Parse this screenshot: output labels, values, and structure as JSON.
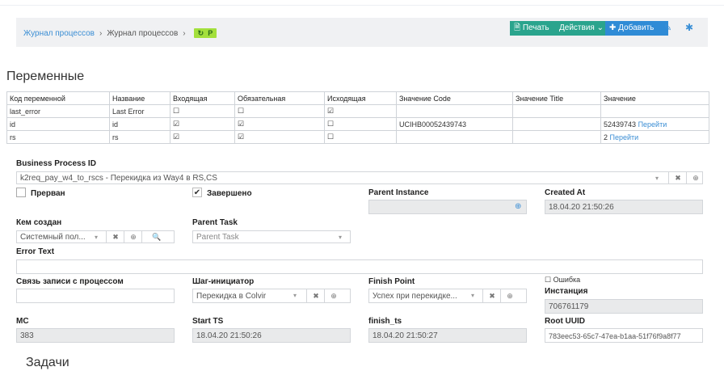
{
  "breadcrumb": {
    "items": [
      "Журнал процессов",
      "Журнал процессов"
    ],
    "chip_glyph": "↻",
    "chip_flag": "Р"
  },
  "toolbar": {
    "print_label": "Печать",
    "actions_label": "Действия",
    "add_label": "Добавить"
  },
  "sections": {
    "variables": "Переменные",
    "tasks": "Задачи"
  },
  "vars_table": {
    "headers": [
      "Код переменной",
      "Название",
      "Входящая",
      "Обязательная",
      "Исходящая",
      "Значение Code",
      "Значение Title",
      "Значение"
    ],
    "rows": [
      {
        "code": "last_error",
        "name": "Last Error",
        "in": false,
        "req": false,
        "out": true,
        "value_code": "",
        "value_title": "",
        "value": "",
        "link": ""
      },
      {
        "code": "id",
        "name": "id",
        "in": true,
        "req": true,
        "out": false,
        "value_code": "UCIHB00052439743",
        "value_title": "",
        "value": "52439743",
        "link": "Перейти"
      },
      {
        "code": "rs",
        "name": "rs",
        "in": true,
        "req": true,
        "out": false,
        "value_code": "",
        "value_title": "",
        "value": "2",
        "link": "Перейти"
      }
    ]
  },
  "form": {
    "bp_id_label": "Business Process ID",
    "bp_id_value": "k2req_pay_w4_to_rscs - Перекидка из Way4 в RS,CS",
    "interrupted_label": "Прерван",
    "completed_label": "Завершено",
    "parent_instance_label": "Parent Instance",
    "created_at_label": "Created At",
    "created_at_value": "18.04.20 21:50:26",
    "created_by_label": "Кем создан",
    "created_by_value": "Системный пол...",
    "parent_task_label": "Parent Task",
    "parent_task_placeholder": "Parent Task",
    "error_text_label": "Error Text",
    "link_label": "Связь записи с процессом",
    "initiator_label": "Шаг-инициатор",
    "initiator_value": "Перекидка в Colvir",
    "finish_point_label": "Finish Point",
    "finish_point_value": "Успех при перекидке...",
    "error_checkbox_label": "Ошибка",
    "instance_label": "Инстанция",
    "instance_value": "706761179",
    "mc_label": "MC",
    "mc_value": "383",
    "start_ts_label": "Start TS",
    "start_ts_value": "18.04.20 21:50:26",
    "finish_ts_label": "finish_ts",
    "finish_ts_value": "18.04.20 21:50:27",
    "root_uuid_label": "Root UUID",
    "root_uuid_value": "783eec53-65c7-47ea-b1aa-51f76f9a8f77"
  },
  "colors": {
    "accent_teal": "#2aa48d",
    "accent_blue": "#2f8bd6",
    "chip_green": "#a3e03c"
  }
}
